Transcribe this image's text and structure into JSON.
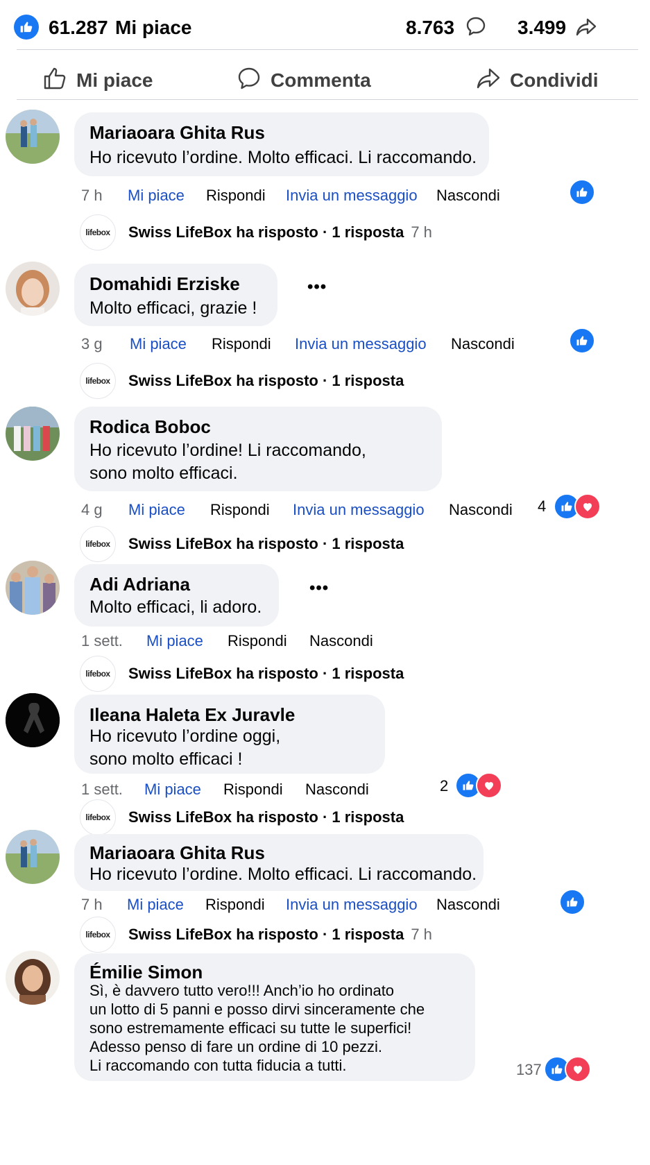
{
  "stats": {
    "likes": "61.287",
    "likes_label": "Mi piace",
    "comments": "8.763",
    "shares": "3.499"
  },
  "actions": {
    "like": "Mi piace",
    "comment": "Commenta",
    "share": "Condividi"
  },
  "colors": {
    "accent": "#1877f2",
    "link": "#1a4fc4",
    "love": "#f33e58",
    "bubble": "#f0f2f5"
  },
  "comments": [
    {
      "author": "Mariaoara Ghita Rus",
      "text": "Ho ricevuto l’ordine. Molto efficaci. Li raccomando.",
      "time": "7 h",
      "like": "Mi piace",
      "reply": "Rispondi",
      "message": "Invia un messaggio",
      "hide": "Nascondi",
      "reply_summary": "Swiss LifeBox ha risposto · 1 risposta",
      "reply_time": "7 h",
      "reply_logo": "lifebox"
    },
    {
      "author": "Domahidi Erziske",
      "text": "Molto efficaci, grazie !",
      "time": "3 g",
      "like": "Mi piace",
      "reply": "Rispondi",
      "message": "Invia un messaggio",
      "hide": "Nascondi",
      "reply_summary": "Swiss LifeBox ha risposto · 1 risposta",
      "reply_logo": "lifebox",
      "more": "•••"
    },
    {
      "author": "Rodica Boboc",
      "text": "Ho ricevuto l’ordine! Li raccomando,\nsono molto efficaci.",
      "time": "4 g",
      "like": "Mi piace",
      "reply": "Rispondi",
      "message": "Invia un messaggio",
      "hide": "Nascondi",
      "reactions": "4",
      "reply_summary": "Swiss LifeBox ha risposto · 1 risposta",
      "reply_logo": "lifebox"
    },
    {
      "author": "Adi Adriana",
      "text": "Molto efficaci, li adoro.",
      "time": "1 sett.",
      "like": "Mi piace",
      "reply": "Rispondi",
      "hide": "Nascondi",
      "reply_summary": "Swiss LifeBox ha risposto · 1 risposta",
      "reply_logo": "lifebox",
      "more": "•••"
    },
    {
      "author": "Ileana Haleta Ex Juravle",
      "text": "Ho ricevuto l’ordine oggi,\nsono molto efficaci !",
      "time": "1 sett.",
      "like": "Mi piace",
      "reply": "Rispondi",
      "hide": "Nascondi",
      "reactions": "2",
      "reply_summary": "Swiss LifeBox ha risposto · 1 risposta",
      "reply_logo": "lifebox"
    },
    {
      "author": "Mariaoara Ghita Rus",
      "text": "Ho ricevuto l’ordine. Molto efficaci. Li raccomando.",
      "time": "7 h",
      "like": "Mi piace",
      "reply": "Rispondi",
      "message": "Invia un messaggio",
      "hide": "Nascondi",
      "reply_summary": "Swiss LifeBox ha risposto · 1 risposta",
      "reply_time": "7 h",
      "reply_logo": "lifebox"
    },
    {
      "author": "Émilie Simon",
      "text": "Sì, è davvero tutto vero!!! Anch’io ho ordinato\nun lotto di 5 panni e posso dirvi sinceramente che\nsono estremamente efficaci su tutte le superfici!\nAdesso penso di fare un ordine di 10 pezzi.\nLi raccomando con tutta fiducia a tutti.",
      "reactions": "137"
    }
  ]
}
